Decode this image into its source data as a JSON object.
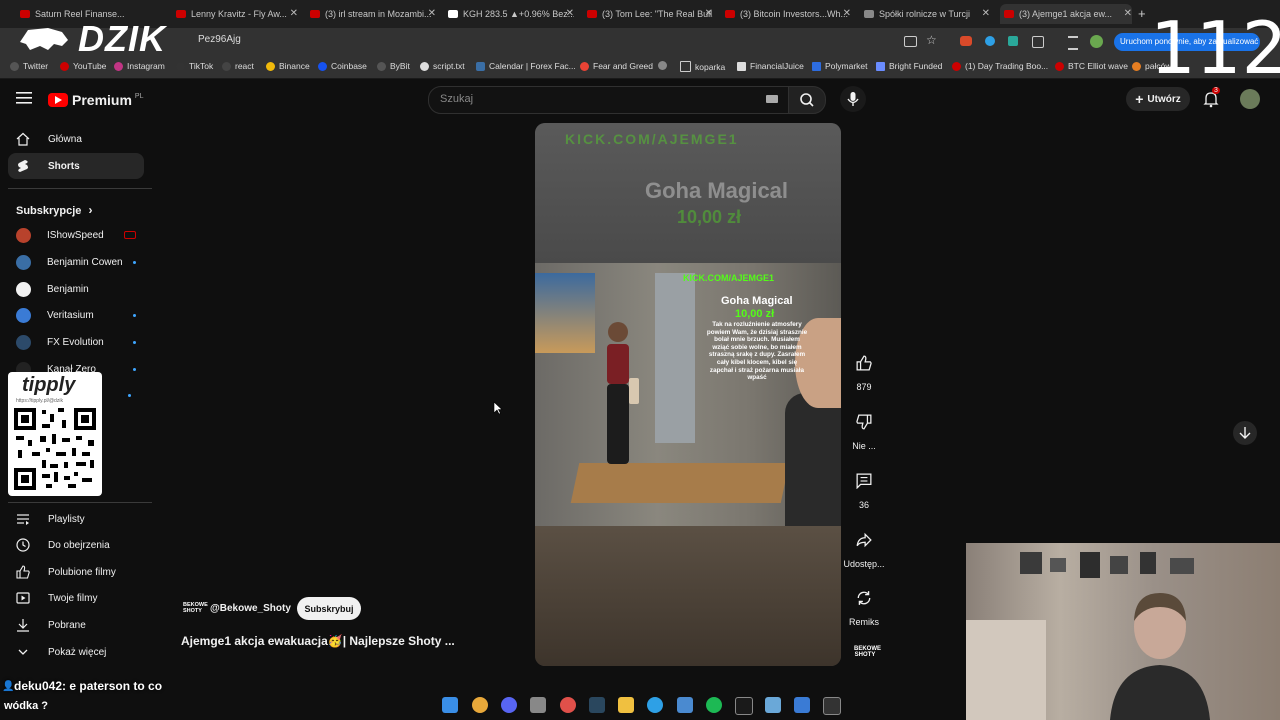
{
  "browser": {
    "tabs": [
      {
        "label": "Saturn Reel Finanse...",
        "color": "#cc0000"
      },
      {
        "label": "Lenny Kravitz - Fly Aw...",
        "color": "#cc0000"
      },
      {
        "label": "(3) irl stream in Mozambi...",
        "color": "#cc0000"
      },
      {
        "label": "KGH 283.5 ▲+0.96% Bez...",
        "color": "#ffffff"
      },
      {
        "label": "(3) Tom Lee: \"The Real Bull...",
        "color": "#cc0000"
      },
      {
        "label": "(3) Bitcoin Investors...Wh...",
        "color": "#cc0000"
      },
      {
        "label": "Spółki rolnicze w Turcji",
        "color": "#888888"
      },
      {
        "label": "(3) Ajemge1 akcja ew...",
        "color": "#cc0000"
      }
    ],
    "new_tab": "+",
    "url": "Pez96Ajg",
    "update_button": "Uruchom ponownie, aby zaktualizować",
    "bookmarks": [
      "Twitter",
      "YouTube",
      "Instagram",
      "TikTok",
      "react",
      "Binance",
      "Coinbase",
      "ByBit",
      "script.txt",
      "Calendar | Forex Fac...",
      "Fear and Greed",
      "",
      "koparka",
      "FinancialJuice",
      "Polymarket",
      "Bright Funded",
      "(1) Day Trading Boo...",
      "BTC Elliot wave",
      "pałców"
    ]
  },
  "overlay": {
    "brand": "DZIK",
    "counter": "112"
  },
  "youtube": {
    "logo": "Premium",
    "logo_region": "PL",
    "search_placeholder": "Szukaj",
    "create_label": "Utwórz",
    "notif_count": "3",
    "nav": [
      {
        "label": "Główna",
        "icon": "home-icon"
      },
      {
        "label": "Shorts",
        "icon": "shorts-icon"
      }
    ],
    "subs_header": "Subskrypcje",
    "subscriptions": [
      {
        "name": "IShowSpeed",
        "color": "#b8422c",
        "live": true
      },
      {
        "name": "Benjamin Cowen",
        "color": "#3a6ea5",
        "live": false
      },
      {
        "name": "Benjamin",
        "color": "#f1f1f1",
        "live": false
      },
      {
        "name": "Veritasium",
        "color": "#3a7bd5",
        "live": false
      },
      {
        "name": "FX Evolution",
        "color": "#2c4a6a",
        "live": false
      },
      {
        "name": "Kanał Zero",
        "color": "#222222",
        "live": false
      }
    ],
    "you_items": [
      {
        "label": "Playlisty",
        "icon": "playlist-icon"
      },
      {
        "label": "Do obejrzenia",
        "icon": "clock-icon"
      },
      {
        "label": "Polubione filmy",
        "icon": "like-icon"
      },
      {
        "label": "Twoje filmy",
        "icon": "video-icon"
      },
      {
        "label": "Pobrane",
        "icon": "download-icon"
      },
      {
        "label": "Pokaż więcej",
        "icon": "chevron-down-icon"
      }
    ],
    "tipply": {
      "title": "tipply",
      "url": "https://tipply.pl/@dzik"
    }
  },
  "short": {
    "overlay_site": "KICK.COM/AJEMGE1",
    "donor": "Goha Magical",
    "amount": "10,00 zł",
    "message": "Tak na rozluźnienie atmosfery powiem Wam, że dzisiaj strasznie bolał mnie brzuch. Musiałem wziąć sobie wolne, bo miałem straszną srakę z dupy. Zasrałem cały kibel klocem, kibel się zapchał i straż pożarna musiała wpaść",
    "channel": "@Bekowe_Shoty",
    "channel_logo": "BEKOWE SHOTY",
    "subscribe": "Subskrybuj",
    "title": "Ajemge1 akcja ewakuacja🥳| Najlepsze Shoty ...",
    "actions": [
      {
        "label": "879",
        "icon": "thumbs-up-icon"
      },
      {
        "label": "Nie ...",
        "icon": "thumbs-down-icon"
      },
      {
        "label": "36",
        "icon": "comment-icon"
      },
      {
        "label": "Udostęp...",
        "icon": "share-icon"
      },
      {
        "label": "Remiks",
        "icon": "remix-icon"
      }
    ]
  },
  "chat": {
    "user": "deku042",
    "message": ": e paterson to co",
    "message2": "wódka ?"
  }
}
